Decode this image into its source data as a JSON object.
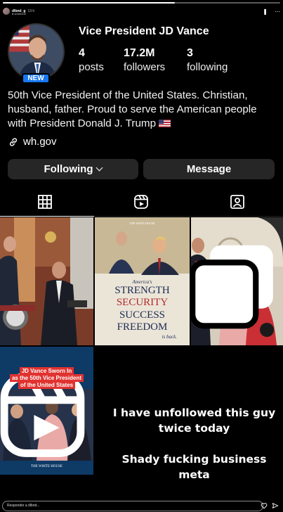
{
  "story": {
    "username": "dlbnd_g",
    "time": "13 h",
    "subtitle": "● someone",
    "progress": 0.62
  },
  "profile": {
    "name": "Vice President JD Vance",
    "new_badge": "NEW",
    "stats": [
      {
        "value": "4",
        "label": "posts"
      },
      {
        "value": "17.2M",
        "label": "followers"
      },
      {
        "value": "3",
        "label": "following"
      }
    ],
    "bio": "50th Vice President of the United States. Christian, husband, father. Proud to serve the American people with President Donald J. Trump",
    "link": "wh.gov"
  },
  "buttons": {
    "following": "Following",
    "message": "Message"
  },
  "tabs": [
    {
      "icon": "grid-icon",
      "active": true
    },
    {
      "icon": "reels-icon",
      "active": false
    },
    {
      "icon": "tagged-icon",
      "active": false
    }
  ],
  "posts": {
    "post2": {
      "header": "THE WHITE HOUSE",
      "lines": [
        "America's",
        "STRENGTH",
        "SECURITY",
        "SUCCESS",
        "FREEDOM",
        "is back."
      ]
    },
    "post4": {
      "lines": [
        "JD Vance Sworn In",
        "as the 50th Vice President",
        "of the United States"
      ],
      "footer": "THE WHITE HOUSE"
    }
  },
  "overlay": {
    "line1": "I have unfollowed this guy",
    "line2": "twice today",
    "line3": "Shady fucking business",
    "line4": "meta"
  },
  "reply": {
    "placeholder": "Responder a dlbnd..."
  },
  "colors": {
    "background": "#000000",
    "button": "#262626",
    "badge": "#1877f2",
    "accent_red": "#e0322f"
  }
}
